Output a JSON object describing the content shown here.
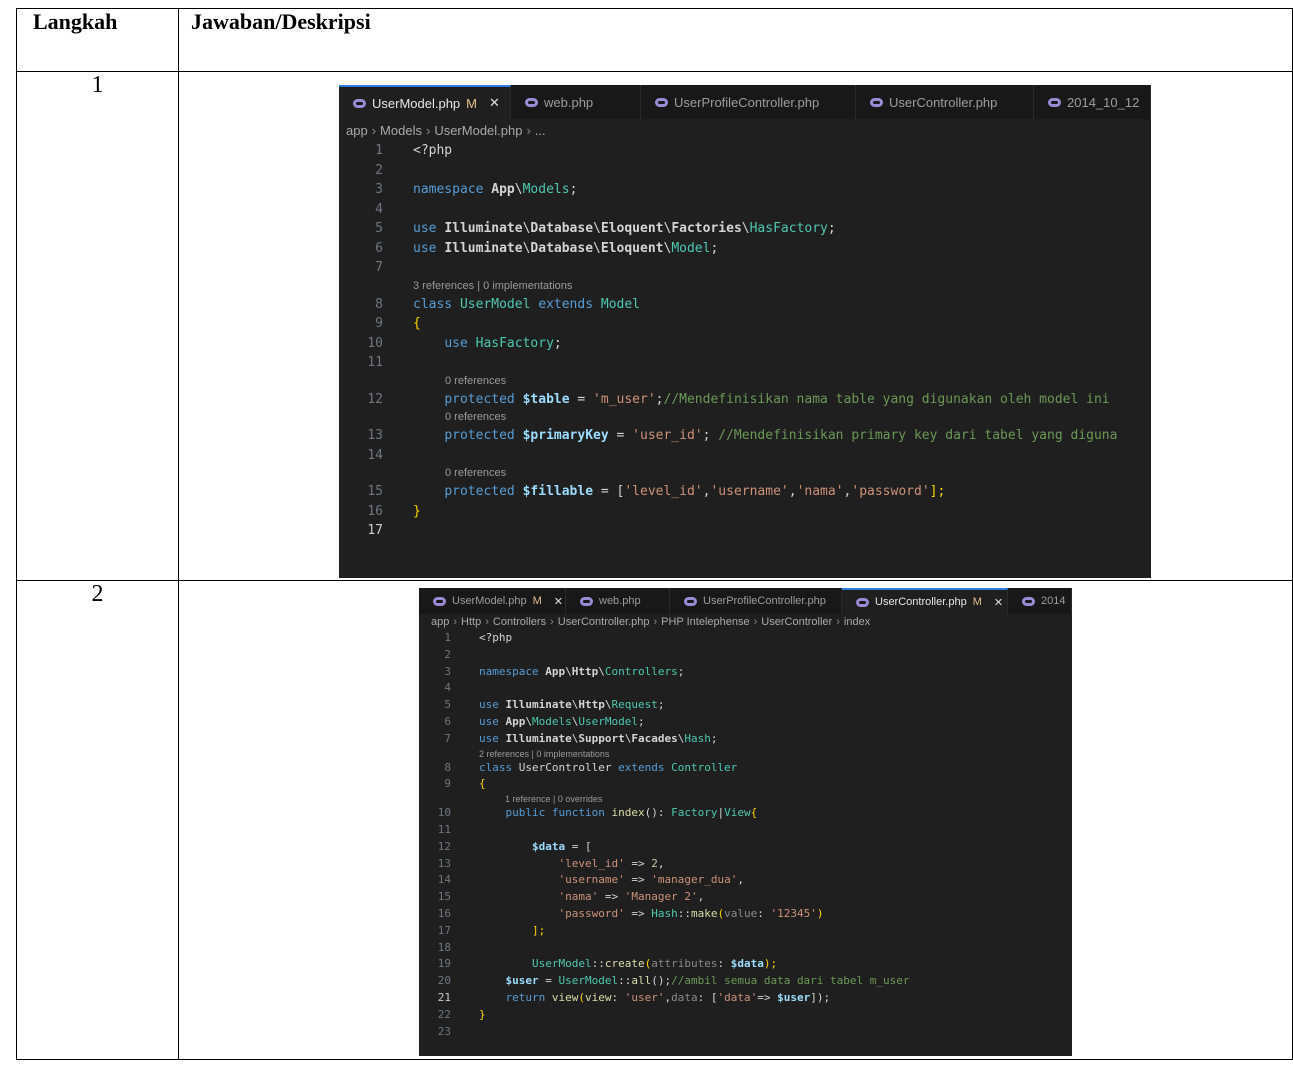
{
  "table": {
    "header": {
      "col1": "Langkah",
      "col2": "Jawaban/Deskripsi"
    },
    "rows": [
      {
        "step": "1"
      },
      {
        "step": "2"
      }
    ]
  },
  "shot1": {
    "tabs": [
      {
        "label": "UserModel.php",
        "modified": "M",
        "close": "✕",
        "active": true
      },
      {
        "label": "web.php"
      },
      {
        "label": "UserProfileController.php"
      },
      {
        "label": "UserController.php"
      },
      {
        "label": "2014_10_12"
      }
    ],
    "breadcrumb": [
      "app",
      "Models",
      "UserModel.php",
      "..."
    ],
    "code": [
      {
        "n": "1",
        "t": "<?php"
      },
      {
        "n": "2",
        "t": ""
      },
      {
        "n": "3",
        "t": "namespace App\\Models;"
      },
      {
        "n": "4",
        "t": ""
      },
      {
        "n": "5",
        "t": "use Illuminate\\Database\\Eloquent\\Factories\\HasFactory;"
      },
      {
        "n": "6",
        "t": "use Illuminate\\Database\\Eloquent\\Model;"
      },
      {
        "n": "7",
        "t": ""
      },
      {
        "ref": "3 references | 0 implementations"
      },
      {
        "n": "8",
        "t": "class UserModel extends Model"
      },
      {
        "n": "9",
        "t": "{"
      },
      {
        "n": "10",
        "t": "    use HasFactory;"
      },
      {
        "n": "11",
        "t": ""
      },
      {
        "ref": "    0 references"
      },
      {
        "n": "12",
        "t": "    protected $table = 'm_user';//Mendefinisikan nama table yang digunakan oleh model ini"
      },
      {
        "ref": "    0 references"
      },
      {
        "n": "13",
        "t": "    protected $primaryKey = 'user_id'; //Mendefinisikan primary key dari tabel yang diguna"
      },
      {
        "n": "14",
        "t": ""
      },
      {
        "ref": "    0 references"
      },
      {
        "n": "15",
        "t": "    protected $fillable = ['level_id','username','nama','password'];"
      },
      {
        "n": "16",
        "t": "}"
      },
      {
        "n": "17",
        "t": ""
      }
    ]
  },
  "shot2": {
    "tabs": [
      {
        "label": "UserModel.php",
        "modified": "M",
        "close": "✕"
      },
      {
        "label": "web.php"
      },
      {
        "label": "UserProfileController.php"
      },
      {
        "label": "UserController.php",
        "modified": "M",
        "close": "✕",
        "active": true
      },
      {
        "label": "2014"
      }
    ],
    "breadcrumb": [
      "app",
      "Http",
      "Controllers",
      "UserController.php",
      "PHP Intelephense",
      "UserController",
      "index"
    ],
    "code": [
      {
        "n": "1",
        "t": "<?php"
      },
      {
        "n": "2",
        "t": ""
      },
      {
        "n": "3",
        "t": "namespace App\\Http\\Controllers;"
      },
      {
        "n": "4",
        "t": ""
      },
      {
        "n": "5",
        "t": "use Illuminate\\Http\\Request;"
      },
      {
        "n": "6",
        "t": "use App\\Models\\UserModel;"
      },
      {
        "n": "7",
        "t": "use Illuminate\\Support\\Facades\\Hash;"
      },
      {
        "ref": "2 references | 0 implementations"
      },
      {
        "n": "8",
        "t": "class UserController extends Controller"
      },
      {
        "n": "9",
        "t": "{"
      },
      {
        "ref": "    1 reference | 0 overrides"
      },
      {
        "n": "10",
        "t": "    public function index(): Factory|View{"
      },
      {
        "n": "11",
        "t": ""
      },
      {
        "n": "12",
        "t": "        $data = ["
      },
      {
        "n": "13",
        "t": "            'level_id' => 2,"
      },
      {
        "n": "14",
        "t": "            'username' => 'manager_dua',"
      },
      {
        "n": "15",
        "t": "            'nama' => 'Manager 2',"
      },
      {
        "n": "16",
        "t": "            'password' => Hash::make(value: '12345')"
      },
      {
        "n": "17",
        "t": "        ];"
      },
      {
        "n": "18",
        "t": ""
      },
      {
        "n": "19",
        "t": "        UserModel::create(attributes: $data);"
      },
      {
        "n": "20",
        "t": "    $user = UserModel::all();//ambil semua data dari tabel m_user"
      },
      {
        "n": "21",
        "t": "    return view(view: 'user',data: ['data'=> $user]);"
      },
      {
        "n": "22",
        "t": "}"
      },
      {
        "n": "23",
        "t": ""
      }
    ]
  },
  "colors": {
    "editor_bg": "#1f1f1f",
    "tabbar_bg": "#181818",
    "active_tab_border": "#2f7de1",
    "keyword": "#569cd6",
    "type": "#4ec9b0",
    "string": "#ce9178",
    "comment": "#6a9955",
    "git_added": "#2ea043",
    "git_modified": "#0c7ad5"
  }
}
